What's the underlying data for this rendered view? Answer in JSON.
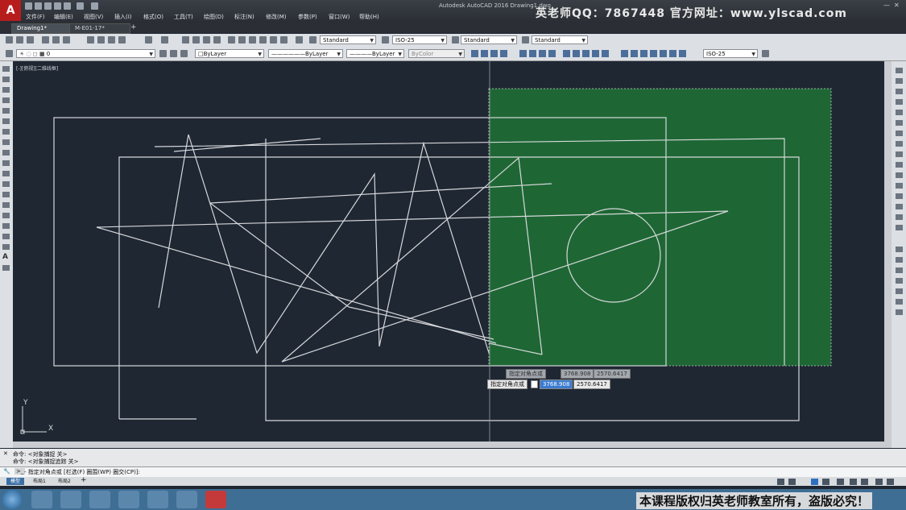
{
  "title": {
    "app_name": "Autodesk AutoCAD 2016",
    "drawing_name": "Drawing1.dwg",
    "watermark_top": "英老师QQ：7867448 官方网址：www.ylscad.com",
    "app_button": "A"
  },
  "menu": [
    "文件(F)",
    "编辑(E)",
    "视图(V)",
    "插入(I)",
    "格式(O)",
    "工具(T)",
    "绘图(D)",
    "标注(N)",
    "修改(M)",
    "参数(P)",
    "窗口(W)",
    "帮助(H)"
  ],
  "tabs": [
    {
      "label": "Drawing1*",
      "active": true
    },
    {
      "label": "M-E01-17*",
      "active": false
    }
  ],
  "toolbar": {
    "text_style": "Standard",
    "dim_style": "ISO-25",
    "table_style": "Standard",
    "mleader_style": "Standard",
    "layer": "0",
    "color": "ByLayer",
    "linetype": "ByLayer",
    "lineweight": "ByLayer",
    "plot_style": "ByColor",
    "dim_style_2": "ISO-25"
  },
  "viewport_label": "[-][俯视][二维线框]",
  "dynamic_input": {
    "prompt": "指定对角点或",
    "x_value": "3768.908",
    "y_value": "2570.6417",
    "ghost_prompt": "指定对角点或",
    "ghost_x": "3768.908",
    "ghost_y": "2570.6417"
  },
  "ucs": {
    "x_label": "X",
    "y_label": "Y"
  },
  "command": {
    "history": [
      "命令: <对象捕捉 关>",
      "命令: <对象捕捉追踪 关>"
    ],
    "prompt": "- 指定对角点或 [栏选(F) 圈围(WP) 圈交(CP)]:"
  },
  "layout_tabs": [
    {
      "label": "模型",
      "active": true
    },
    {
      "label": "布局1",
      "active": false
    },
    {
      "label": "布局2",
      "active": false
    }
  ],
  "watermark_bottom": "本课程版权归英老师教室所有，盗版必究！",
  "colors": {
    "canvas": "#1f2733",
    "selection_fill": "#1e6b35",
    "lines": "#d8dadc"
  }
}
